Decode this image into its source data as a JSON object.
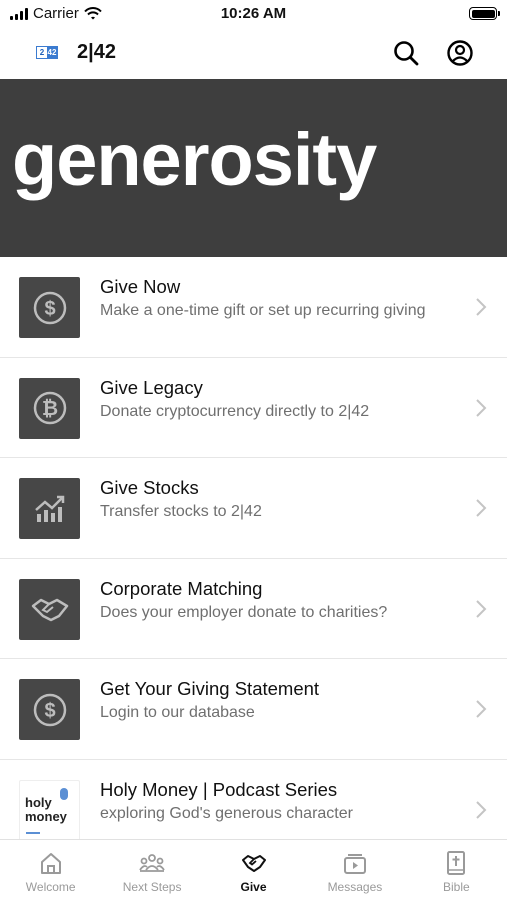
{
  "status_bar": {
    "carrier": "Carrier",
    "time": "10:26 AM"
  },
  "header": {
    "logo_left": "2",
    "logo_right": "42",
    "title": "2|42"
  },
  "banner": {
    "title": "generosity"
  },
  "give_items": [
    {
      "title": "Give Now",
      "subtitle": "Make a one-time gift or set up recurring giving",
      "icon": "dollar-coin-icon"
    },
    {
      "title": "Give Legacy",
      "subtitle": "Donate cryptocurrency directly to 2|42",
      "icon": "bitcoin-icon"
    },
    {
      "title": "Give Stocks",
      "subtitle": "Transfer stocks to 2|42",
      "icon": "stocks-chart-icon"
    },
    {
      "title": "Corporate Matching",
      "subtitle": "Does your employer donate to charities?",
      "icon": "handshake-icon"
    },
    {
      "title": "Get Your Giving Statement",
      "subtitle": "Login to our database",
      "icon": "dollar-coin-icon"
    },
    {
      "title": "Holy Money | Podcast Series",
      "subtitle": "exploring God's generous character",
      "icon": "podcast-artwork",
      "thumb_text": "holy money"
    }
  ],
  "tabs": [
    {
      "label": "Welcome",
      "icon": "church-icon",
      "active": false
    },
    {
      "label": "Next Steps",
      "icon": "people-icon",
      "active": false
    },
    {
      "label": "Give",
      "icon": "handshake-icon",
      "active": true
    },
    {
      "label": "Messages",
      "icon": "video-icon",
      "active": false
    },
    {
      "label": "Bible",
      "icon": "bible-icon",
      "active": false
    }
  ],
  "colors": {
    "banner_bg": "#3e3e3e",
    "thumb_bg": "#474747",
    "accent_blue": "#3b7bd0",
    "inactive_tab": "#9a9a9a"
  }
}
